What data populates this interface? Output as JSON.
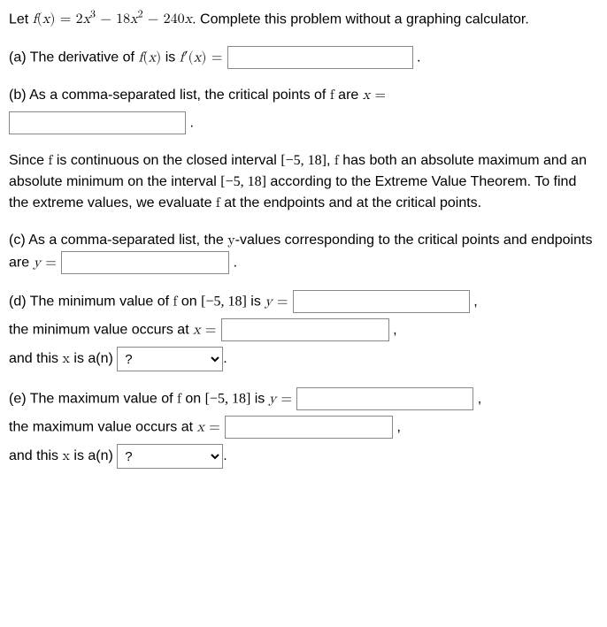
{
  "intro": {
    "prefix": "Let ",
    "func_lhs": "f(x) = ",
    "func_rhs": "2x³ − 18x² − 240x",
    "suffix": ". Complete this problem without a graphing calculator."
  },
  "a": {
    "text_prefix": "(a) The derivative of ",
    "fx": "f(x)",
    "text_mid": " is ",
    "fpx": "f′(x) = ",
    "period": "."
  },
  "b": {
    "text": "(b) As a comma-separated list, the critical points of ",
    "f": "f",
    "text2": " are ",
    "xeq": "x = ",
    "period": "."
  },
  "explain": {
    "p1a": "Since ",
    "f": "f",
    "p1b": " is continuous on the closed interval ",
    "int": "[−5, 18]",
    "p1c": ", ",
    "p1d": " has both an absolute maximum and an absolute minimum on the interval ",
    "p1e": " according to the Extreme Value Theorem. To find the extreme values, we evaluate ",
    "p1f": " at the endpoints and at the critical points."
  },
  "c": {
    "text1": "(c) As a comma-separated list, the ",
    "yvar": "y",
    "text2": "-values corresponding to the critical points and endpoints are ",
    "yeq": "y = ",
    "period": "."
  },
  "d": {
    "t1": "(d) The minimum value of ",
    "f": "f",
    "t2": " on ",
    "int": "[−5, 18]",
    "t3": " is ",
    "yeq": "y = ",
    "comma": ",",
    "t4": "the minimum value occurs at ",
    "xeq": "x = ",
    "t5": "and this ",
    "xvar": "x",
    "t6": " is a(n)",
    "period": ".",
    "select_placeholder": "?"
  },
  "e": {
    "t1": "(e) The maximum value of ",
    "f": "f",
    "t2": " on ",
    "int": "[−5, 18]",
    "t3": " is ",
    "yeq": "y = ",
    "comma": ",",
    "t4": "the maximum value occurs at ",
    "xeq": "x = ",
    "t5": "and this ",
    "xvar": "x",
    "t6": " is a(n)",
    "period": ".",
    "select_placeholder": "?"
  }
}
